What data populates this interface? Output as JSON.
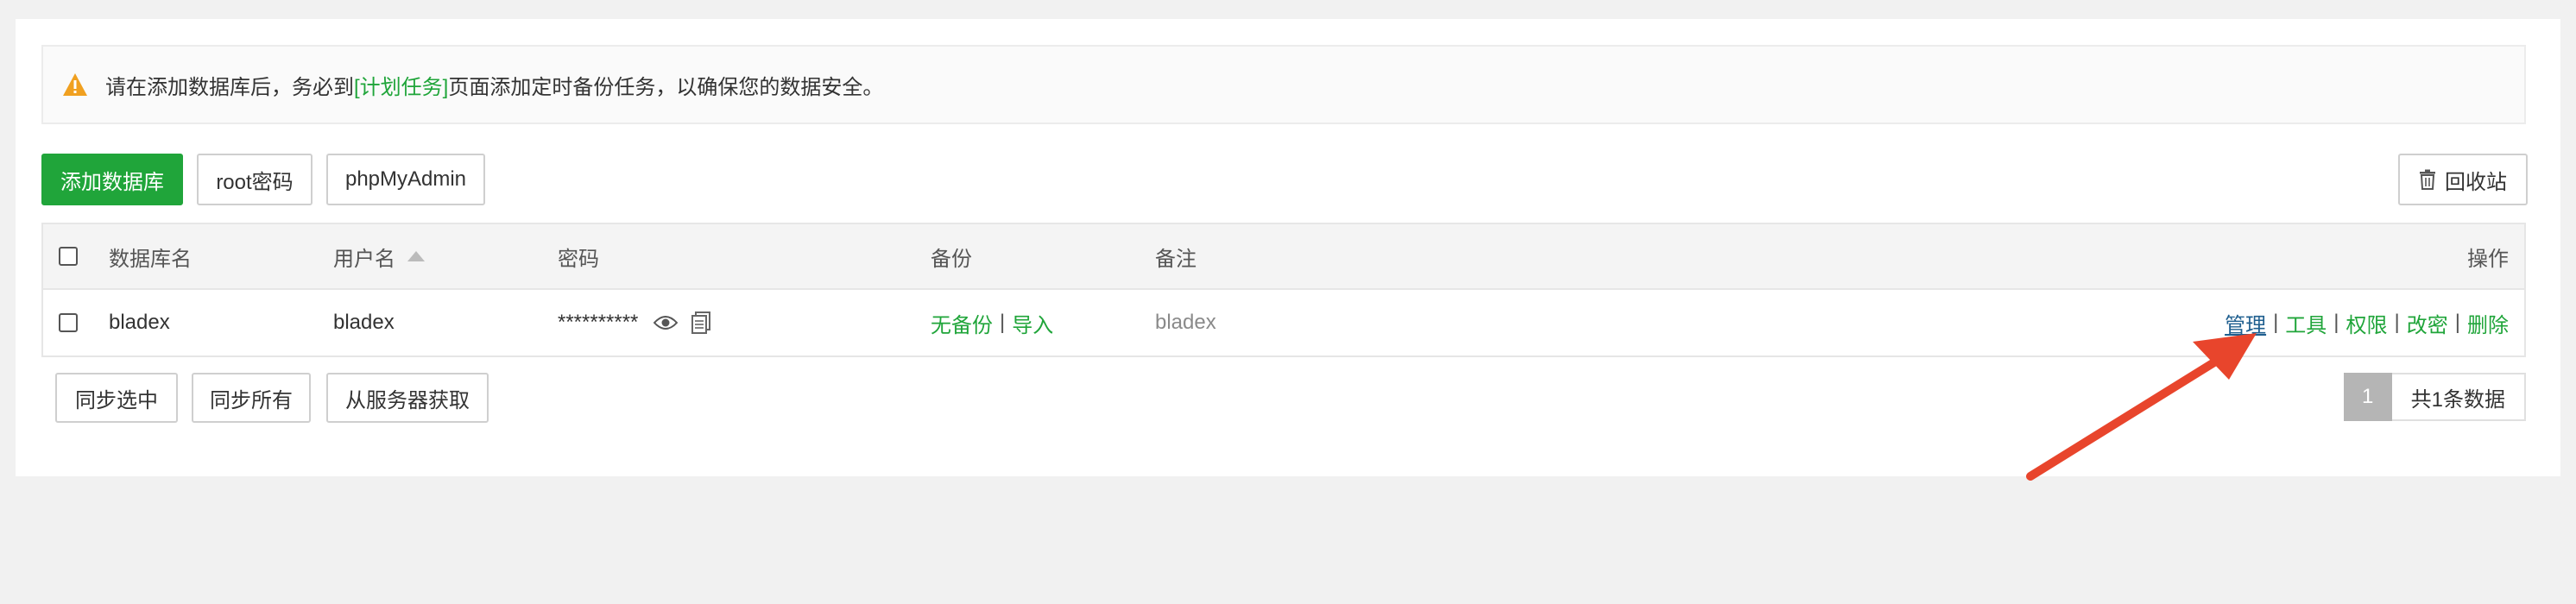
{
  "notice": {
    "text_before": "请在添加数据库后，务必到",
    "link_text": "[计划任务]",
    "text_after": "页面添加定时备份任务，以确保您的数据安全。"
  },
  "toolbar": {
    "add_db": "添加数据库",
    "root_pwd": "root密码",
    "phpmyadmin": "phpMyAdmin",
    "recycle": "回收站"
  },
  "table": {
    "headers": {
      "db_name": "数据库名",
      "username": "用户名",
      "password": "密码",
      "backup": "备份",
      "remark": "备注",
      "actions": "操作"
    },
    "rows": [
      {
        "db_name": "bladex",
        "username": "bladex",
        "password": "**********",
        "backup_status": "无备份",
        "import": "导入",
        "remark": "bladex",
        "actions": {
          "manage": "管理",
          "tools": "工具",
          "perms": "权限",
          "change_pwd": "改密",
          "delete": "删除"
        }
      }
    ]
  },
  "footer": {
    "sync_selected": "同步选中",
    "sync_all": "同步所有",
    "fetch_from_server": "从服务器获取"
  },
  "pagination": {
    "current_page": "1",
    "total_text": "共1条数据"
  },
  "colors": {
    "accent": "#20a53a",
    "warning": "#f0a020",
    "annotation_arrow": "#e8452c"
  }
}
